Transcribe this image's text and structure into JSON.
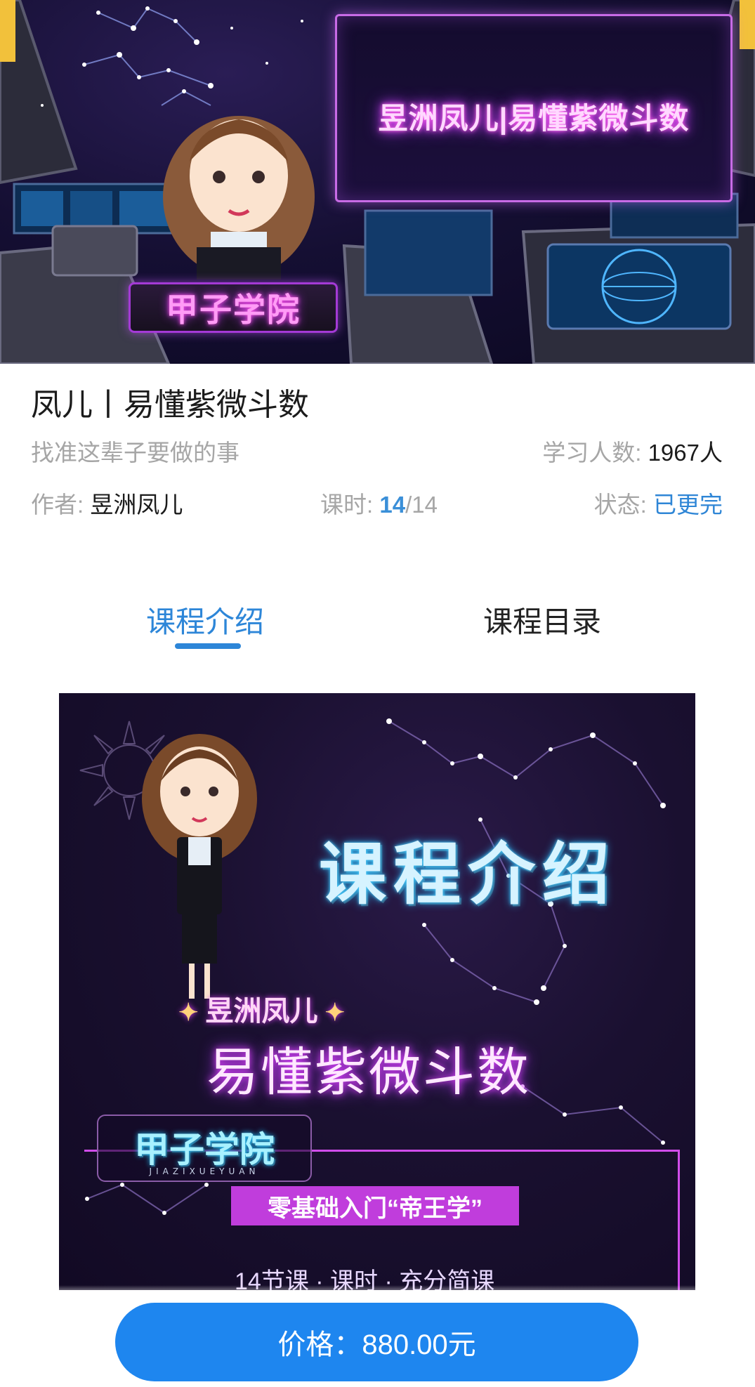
{
  "hero": {
    "screen_title": "昱洲凤儿|易懂紫微斗数",
    "badge": "甲子学院"
  },
  "course": {
    "title": "凤儿丨易懂紫微斗数",
    "subtitle": "找准这辈子要做的事",
    "learners_label": "学习人数: ",
    "learners_value": "1967人",
    "author_label": "作者: ",
    "author_value": "昱洲凤儿",
    "lessons_label": "课时: ",
    "lessons_done": "14",
    "lessons_total": "/14",
    "status_label": "状态: ",
    "status_value": "已更完"
  },
  "tabs": {
    "intro": "课程介绍",
    "catalog": "课程目录",
    "active": "intro"
  },
  "poster": {
    "heading": "课程介绍",
    "name_spark_left": "✦",
    "name": "昱洲凤儿",
    "name_spark_right": "✦",
    "course": "易懂紫微斗数",
    "badge_main": "甲子学院",
    "badge_sub": "JIAZIXUEYUAN",
    "pill": "零基础入门“帝王学”",
    "cutoff": "14节课 · 课时 · 充分简课"
  },
  "price_button": {
    "label": "价格：880.00元"
  },
  "colors": {
    "accent": "#2d86d8",
    "button": "#1e86ef",
    "muted": "#a6a6a6",
    "text": "#1b1b1b",
    "neon_pink": "#e040fb"
  }
}
